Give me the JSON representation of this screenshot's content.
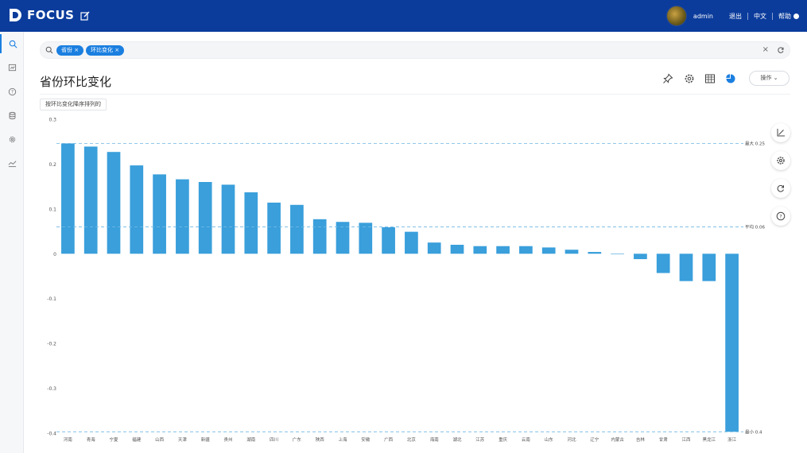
{
  "app": {
    "name": "FOCUS"
  },
  "header": {
    "user": "admin",
    "logout": "退出",
    "language": "中文",
    "help": "帮助"
  },
  "search": {
    "tags": [
      "省份",
      "环比变化"
    ]
  },
  "page": {
    "title": "省份环比变化",
    "ops_label": "操作",
    "sort_label": "按环比变化降序排列的"
  },
  "icons": {
    "logo": "focus-logo-icon",
    "edit": "edit-icon",
    "search": "search-icon",
    "sidebar": [
      "search-icon",
      "board-icon",
      "question-icon",
      "database-icon",
      "settings-icon",
      "trend-icon"
    ],
    "toolbar": [
      "pin-icon",
      "gear-icon",
      "table-icon",
      "pie-icon"
    ],
    "floating": [
      "axis-icon",
      "gear-icon",
      "refresh-icon",
      "help-icon"
    ]
  },
  "colors": {
    "bar": "#3a9fdb",
    "ref_line": "#6fb7e3",
    "header": "#0b3c9c",
    "accent": "#1b7fe0"
  },
  "chart_data": {
    "type": "bar",
    "categories": [
      "河南",
      "青海",
      "宁夏",
      "福建",
      "山西",
      "天津",
      "新疆",
      "贵州",
      "湖南",
      "四川",
      "广东",
      "陕西",
      "上海",
      "安徽",
      "广西",
      "北京",
      "海南",
      "湖北",
      "江苏",
      "重庆",
      "云南",
      "山东",
      "河北",
      "辽宁",
      "内蒙古",
      "吉林",
      "甘肃",
      "江西",
      "黑龙江",
      "浙江"
    ],
    "values": [
      0.246,
      0.239,
      0.227,
      0.197,
      0.177,
      0.166,
      0.16,
      0.154,
      0.137,
      0.114,
      0.109,
      0.077,
      0.071,
      0.069,
      0.059,
      0.049,
      0.025,
      0.02,
      0.017,
      0.017,
      0.017,
      0.014,
      0.009,
      0.004,
      0.0,
      -0.012,
      -0.043,
      -0.061,
      -0.061,
      -0.397
    ],
    "ylim": [
      -0.4,
      0.3
    ],
    "yticks": [
      0.3,
      0.2,
      0.1,
      0,
      -0.1,
      -0.2,
      -0.3,
      -0.4
    ],
    "reference_lines": [
      {
        "label": "最大 0.25",
        "value": 0.246
      },
      {
        "label": "平均 0.06",
        "value": 0.06
      },
      {
        "label": "最小 0.4",
        "value": -0.397
      }
    ]
  }
}
